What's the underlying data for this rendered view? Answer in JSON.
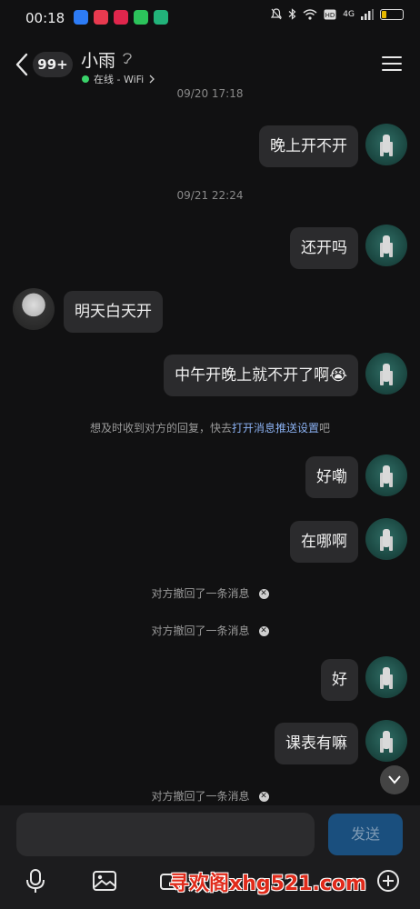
{
  "status_bar": {
    "time": "00:18",
    "network": "4G",
    "battery": "20",
    "battery_level": 0.2
  },
  "header": {
    "unread_count": "99+",
    "contact_name": "小雨",
    "online_status": "在线 - WiFi"
  },
  "messages": [
    {
      "kind": "timestamp",
      "text": "09/20 17:18"
    },
    {
      "kind": "sent",
      "text": "晚上开不开"
    },
    {
      "kind": "timestamp",
      "text": "09/21 22:24"
    },
    {
      "kind": "sent",
      "text": "还开吗"
    },
    {
      "kind": "received",
      "text": "明天白天开"
    },
    {
      "kind": "sent",
      "text": "中午开晚上就不开了啊😭"
    },
    {
      "kind": "system",
      "text_before": "想及时收到对方的回复，快去",
      "link": "打开消息推送设置",
      "text_after": "吧"
    },
    {
      "kind": "sent",
      "text": "好嘞"
    },
    {
      "kind": "sent",
      "text": "在哪啊"
    },
    {
      "kind": "recalled",
      "text": "对方撤回了一条消息"
    },
    {
      "kind": "recalled",
      "text": "对方撤回了一条消息"
    },
    {
      "kind": "sent",
      "text": "好"
    },
    {
      "kind": "sent",
      "text": "课表有嘛"
    },
    {
      "kind": "recalled",
      "text": "对方撤回了一条消息"
    }
  ],
  "input": {
    "send_label": "发送"
  },
  "watermark": "寻欢阁xhg521.com",
  "colors": {
    "background": "#111112",
    "bubble": "#2b2b2d",
    "send_button": "#1a4f7e",
    "link": "#8ab0f0",
    "online_dot": "#3ad36a"
  }
}
